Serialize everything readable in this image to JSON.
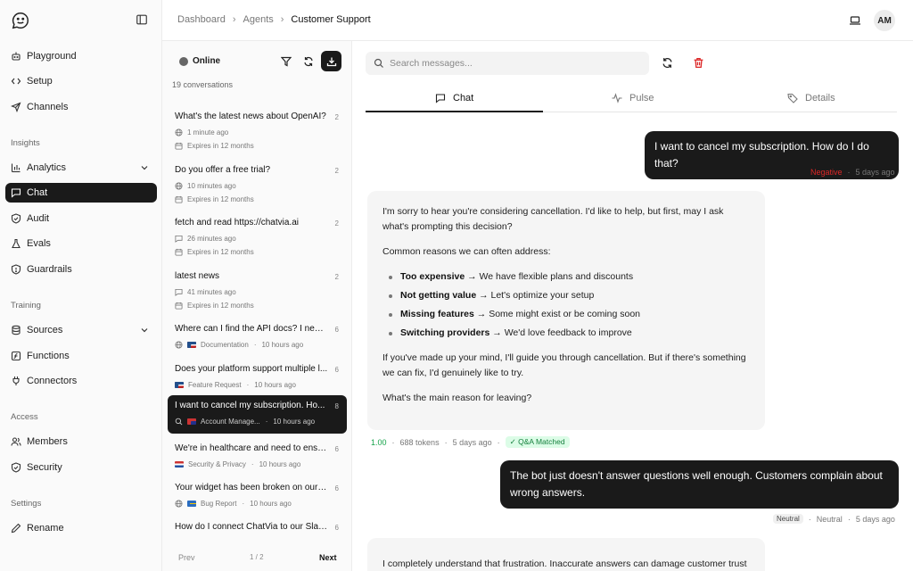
{
  "sidebar": {
    "items_top": [
      {
        "label": "Playground",
        "icon": "bot-icon"
      },
      {
        "label": "Setup",
        "icon": "code-icon"
      },
      {
        "label": "Channels",
        "icon": "send-icon"
      }
    ],
    "sections": {
      "insights": "Insights",
      "training": "Training",
      "access": "Access",
      "settings": "Settings"
    },
    "insights_items": [
      {
        "label": "Analytics"
      },
      {
        "label": "Chat"
      },
      {
        "label": "Audit"
      },
      {
        "label": "Evals"
      },
      {
        "label": "Guardrails"
      }
    ],
    "training_items": [
      {
        "label": "Sources"
      },
      {
        "label": "Functions"
      },
      {
        "label": "Connectors"
      }
    ],
    "access_items": [
      {
        "label": "Members"
      },
      {
        "label": "Security"
      }
    ],
    "settings_items": [
      {
        "label": "Rename"
      }
    ]
  },
  "header": {
    "breadcrumb": [
      "Dashboard",
      "Agents",
      "Customer Support"
    ],
    "avatar": "AM"
  },
  "convlist": {
    "status": "Online",
    "count": "19 conversations",
    "items": [
      {
        "title": "What's the latest news about OpenAI?",
        "num": "2",
        "time": "1 minute ago",
        "expires": "Expires in 12 months"
      },
      {
        "title": "Do you offer a free trial?",
        "num": "2",
        "time": "10 minutes ago",
        "expires": "Expires in 12 months"
      },
      {
        "title": "fetch and read https://chatvia.ai",
        "num": "2",
        "time": "26 minutes ago",
        "expires": "Expires in 12 months"
      },
      {
        "title": "latest news",
        "num": "2",
        "time": "41 minutes ago",
        "expires": "Expires in 12 months"
      },
      {
        "title": "Where can I find the API docs? I need...",
        "num": "6",
        "tag": "Documentation",
        "time": "10 hours ago"
      },
      {
        "title": "Does your platform support multiple l...",
        "num": "6",
        "tag": "Feature Request",
        "time": "10 hours ago"
      },
      {
        "title": "I want to cancel my subscription. Ho...",
        "num": "8",
        "tag": "Account Manage...",
        "time": "10 hours ago"
      },
      {
        "title": "We're in healthcare and need to ensu...",
        "num": "6",
        "tag": "Security & Privacy",
        "time": "10 hours ago"
      },
      {
        "title": "Your widget has been broken on our s...",
        "num": "6",
        "tag": "Bug Report",
        "time": "10 hours ago"
      },
      {
        "title": "How do I connect ChatVia to our Slac...",
        "num": "6"
      }
    ],
    "pager": {
      "prev": "Prev",
      "page": "1 / 2",
      "next": "Next"
    }
  },
  "chat": {
    "search_placeholder": "Search messages...",
    "tabs": [
      "Chat",
      "Pulse",
      "Details"
    ],
    "msg1": {
      "text": "I want to cancel my subscription. How do I do that?",
      "sentiment": "Negative",
      "time": "5 days ago"
    },
    "bot1": {
      "p1": "I'm sorry to hear you're considering cancellation. I'd like to help, but first, may I ask what's prompting this decision?",
      "p2": "Common reasons we can often address:",
      "bullets": [
        {
          "bold": "Too expensive",
          "rest": " → We have flexible plans and discounts"
        },
        {
          "bold": "Not getting value",
          "rest": " → Let's optimize your setup"
        },
        {
          "bold": "Missing features",
          "rest": " → Some might exist or be coming soon"
        },
        {
          "bold": "Switching providers",
          "rest": " → We'd love feedback to improve"
        }
      ],
      "p3": "If you've made up your mind, I'll guide you through cancellation. But if there's something we can fix, I'd genuinely like to try.",
      "p4": "What's the main reason for leaving?",
      "score": "1.00",
      "tokens": "688 tokens",
      "time": "5 days ago",
      "badge": "✓ Q&A Matched"
    },
    "msg2": {
      "text": "The bot just doesn't answer questions well enough. Customers complain about wrong answers.",
      "badge": "Neutral",
      "sentiment": "Neutral",
      "time": "5 days ago"
    },
    "bot2": {
      "p1": "I completely understand that frustration. Inaccurate answers can damage customer trust"
    }
  }
}
